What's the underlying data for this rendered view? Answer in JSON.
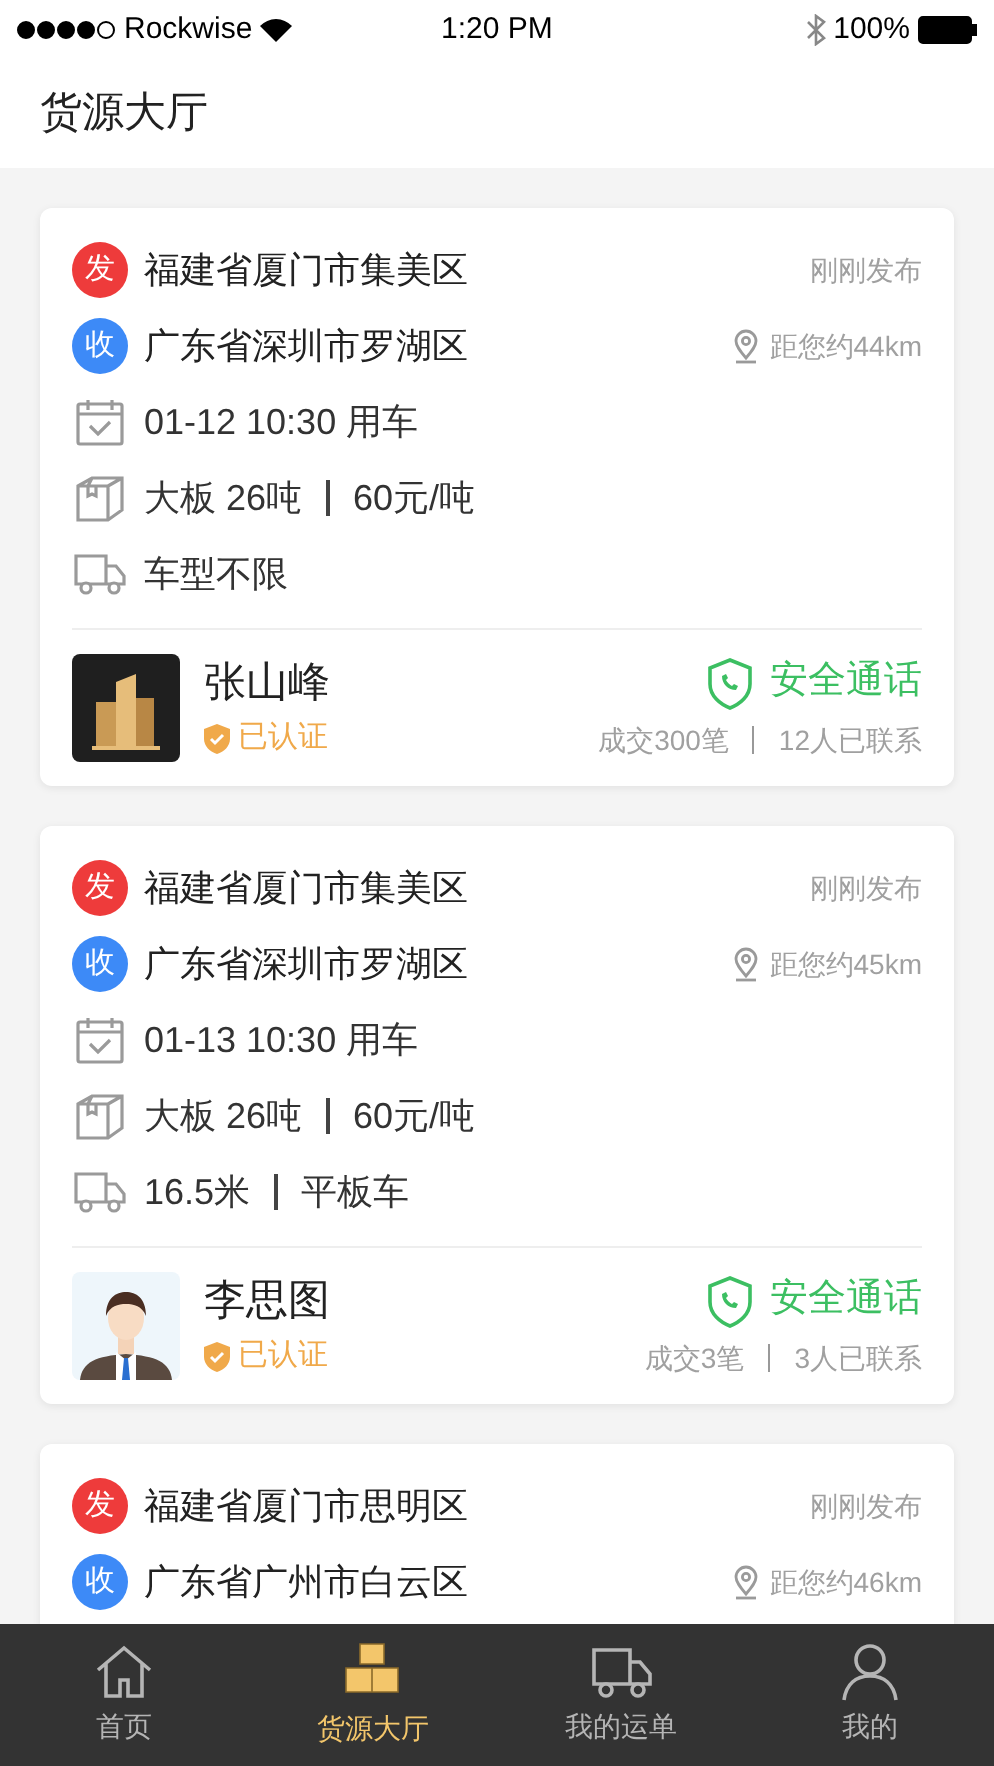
{
  "status_bar": {
    "carrier": "Rockwise",
    "time": "1:20 PM",
    "battery": "100%"
  },
  "header": {
    "title": "货源大厅"
  },
  "cards": [
    {
      "stops": [
        {
          "badge": "发",
          "place": "福建省厦门市集美区",
          "color": "#ee3b3b",
          "side_text": "刚刚发布",
          "kind": "posted"
        },
        {
          "badge": "收",
          "place": "广东省深圳市罗湖区",
          "color": "#3d8af7",
          "side_text": "距您约44km",
          "kind": "distance"
        }
      ],
      "details": [
        {
          "kind": "date",
          "parts": [
            "01-12 10:30 用车"
          ]
        },
        {
          "kind": "cargo",
          "parts": [
            "大板 26吨",
            "60元/吨"
          ]
        },
        {
          "kind": "vehicle",
          "parts": [
            "车型不限"
          ]
        }
      ],
      "shipper": {
        "name": "张山峰",
        "verified": "已认证",
        "kind": "building"
      },
      "call": "安全通话",
      "stats": [
        "成交300笔",
        "12人已联系"
      ]
    },
    {
      "stops": [
        {
          "badge": "发",
          "place": "福建省厦门市集美区",
          "color": "#ee3b3b",
          "side_text": "刚刚发布",
          "kind": "posted"
        },
        {
          "badge": "收",
          "place": "广东省深圳市罗湖区",
          "color": "#3d8af7",
          "side_text": "距您约45km",
          "kind": "distance"
        }
      ],
      "details": [
        {
          "kind": "date",
          "parts": [
            "01-13 10:30 用车"
          ]
        },
        {
          "kind": "cargo",
          "parts": [
            "大板 26吨",
            "60元/吨"
          ]
        },
        {
          "kind": "vehicle",
          "parts": [
            "16.5米",
            "平板车"
          ]
        }
      ],
      "shipper": {
        "name": "李思图",
        "verified": "已认证",
        "kind": "person"
      },
      "call": "安全通话",
      "stats": [
        "成交3笔",
        "3人已联系"
      ]
    },
    {
      "stops": [
        {
          "badge": "发",
          "place": "福建省厦门市思明区",
          "color": "#ee3b3b",
          "side_text": "刚刚发布",
          "kind": "posted"
        },
        {
          "badge": "收",
          "place": "广东省广州市白云区",
          "color": "#3d8af7",
          "side_text": "距您约46km",
          "kind": "distance"
        }
      ]
    }
  ],
  "tab_bar": [
    {
      "label": "首页",
      "kind": "home",
      "selected": false
    },
    {
      "label": "货源大厅",
      "kind": "boxes",
      "selected": true
    },
    {
      "label": "我的运单",
      "kind": "truck",
      "selected": false
    },
    {
      "label": "我的",
      "kind": "user",
      "selected": false
    }
  ]
}
